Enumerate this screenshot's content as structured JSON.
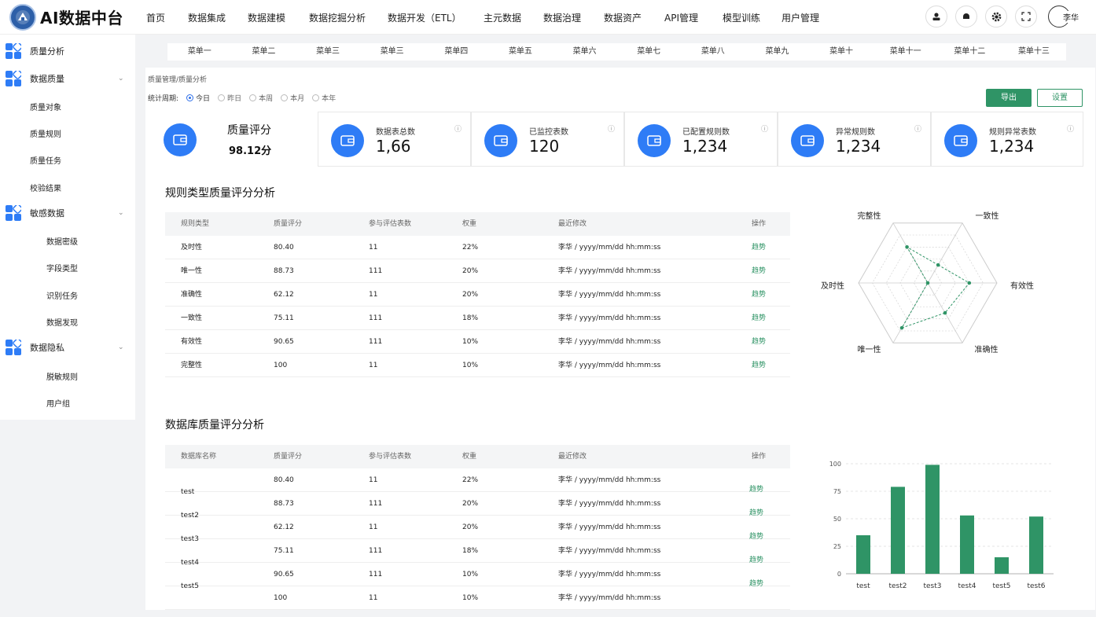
{
  "app": {
    "title": "AI数据中台"
  },
  "topnav": [
    "首页",
    "数据集成",
    "数据建模",
    "数据挖掘分析",
    "数据开发（ETL）",
    "主元数据",
    "数据治理",
    "数据资产",
    "API管理",
    "模型训练",
    "用户管理"
  ],
  "user": {
    "name": "李华"
  },
  "sidebar": {
    "groups": [
      {
        "label": "质量分析",
        "items": []
      },
      {
        "label": "数据质量",
        "items": [
          "质量对象",
          "质量规则",
          "质量任务",
          "校验结果"
        ]
      },
      {
        "label": "敏感数据",
        "items": [
          "数据密级",
          "字段类型",
          "识别任务",
          "数据发现"
        ]
      },
      {
        "label": "数据隐私",
        "items": [
          "脱敏规则",
          "用户组"
        ]
      }
    ]
  },
  "menubar": [
    "菜单一",
    "菜单二",
    "菜单三",
    "菜单三",
    "菜单四",
    "菜单五",
    "菜单六",
    "菜单七",
    "菜单八",
    "菜单九",
    "菜单十",
    "菜单十一",
    "菜单十二",
    "菜单十三"
  ],
  "breadcrumb": "质量管理/质量分析",
  "period": {
    "label": "统计周期:",
    "options": [
      "今日",
      "昨日",
      "本周",
      "本月",
      "本年"
    ],
    "selected": 0
  },
  "actions": {
    "export": "导出",
    "settings": "设置"
  },
  "score": {
    "label": "质量评分",
    "value": "98.12分"
  },
  "stats": [
    {
      "label": "数据表总数",
      "value": "1,66"
    },
    {
      "label": "已监控表数",
      "value": "120"
    },
    {
      "label": "已配置规则数",
      "value": "1,234"
    },
    {
      "label": "异常规则数",
      "value": "1,234"
    },
    {
      "label": "规则异常表数",
      "value": "1,234"
    }
  ],
  "info_icon": "ⓘ",
  "rule_section": {
    "title": "规则类型质量评分分析",
    "headers": [
      "规则类型",
      "质量评分",
      "参与评估表数",
      "权重",
      "最近修改",
      "操作"
    ],
    "rows": [
      [
        "及时性",
        "80.40",
        "11",
        "22%",
        "李华 / yyyy/mm/dd hh:mm:ss",
        "趋势"
      ],
      [
        "唯一性",
        "88.73",
        "111",
        "20%",
        "李华 / yyyy/mm/dd hh:mm:ss",
        "趋势"
      ],
      [
        "准确性",
        "62.12",
        "11",
        "20%",
        "李华 / yyyy/mm/dd hh:mm:ss",
        "趋势"
      ],
      [
        "一致性",
        "75.11",
        "111",
        "18%",
        "李华 / yyyy/mm/dd hh:mm:ss",
        "趋势"
      ],
      [
        "有效性",
        "90.65",
        "111",
        "10%",
        "李华 / yyyy/mm/dd hh:mm:ss",
        "趋势"
      ],
      [
        "完整性",
        "100",
        "11",
        "10%",
        "李华 / yyyy/mm/dd hh:mm:ss",
        "趋势"
      ]
    ]
  },
  "db_section": {
    "title": "数据库质量评分分析",
    "headers": [
      "数据库名称",
      "质量评分",
      "参与评估表数",
      "权重",
      "最近修改",
      "操作"
    ],
    "rows": [
      [
        "",
        "80.40",
        "11",
        "22%",
        "李华 / yyyy/mm/dd hh:mm:ss",
        ""
      ],
      [
        "test",
        "88.73",
        "111",
        "20%",
        "李华 / yyyy/mm/dd hh:mm:ss",
        "趋势"
      ],
      [
        "test2",
        "62.12",
        "11",
        "20%",
        "李华 / yyyy/mm/dd hh:mm:ss",
        "趋势"
      ],
      [
        "test3",
        "75.11",
        "111",
        "18%",
        "李华 / yyyy/mm/dd hh:mm:ss",
        "趋势"
      ],
      [
        "test4",
        "90.65",
        "111",
        "10%",
        "李华 / yyyy/mm/dd hh:mm:ss",
        "趋势"
      ],
      [
        "test5",
        "100",
        "11",
        "10%",
        "李华 / yyyy/mm/dd hh:mm:ss",
        "趋势"
      ]
    ]
  },
  "colors": {
    "accent": "#2f9466",
    "blue": "#2e7cf6"
  },
  "chart_data": [
    {
      "type": "radar",
      "categories": [
        "一致性",
        "有效性",
        "准确性",
        "唯一性",
        "及时性",
        "完整性"
      ],
      "values": [
        30,
        60,
        50,
        75,
        0,
        60
      ],
      "max": 100
    },
    {
      "type": "bar",
      "categories": [
        "test",
        "test2",
        "test3",
        "test4",
        "test5",
        "test6"
      ],
      "values": [
        35,
        79,
        99,
        53,
        15,
        52
      ],
      "ylim": [
        0,
        100
      ],
      "yticks": [
        0,
        25,
        50,
        75,
        100
      ]
    }
  ]
}
